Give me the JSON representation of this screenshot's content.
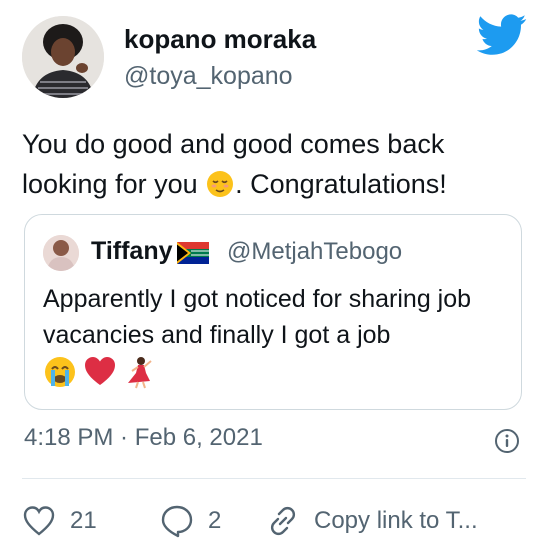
{
  "author": {
    "display_name": "kopano moraka",
    "handle": "@toya_kopano"
  },
  "tweet": {
    "text_before_emoji": "You do good and good comes back looking for you ",
    "text_after_emoji": ". Congratulations!",
    "inline_emoji": "relieved-face-emoji"
  },
  "quoted_tweet": {
    "display_name": "Tiffany",
    "name_emoji": "south-africa-flag-icon",
    "handle": "@MetjahTebogo",
    "text": "Apparently I got  noticed for sharing job vacancies and finally I got a job",
    "emojis": [
      "crying-face-emoji",
      "red-heart-emoji",
      "dancing-woman-emoji"
    ]
  },
  "meta": {
    "timestamp": "4:18 PM · Feb 6, 2021"
  },
  "actions": {
    "like_count": "21",
    "reply_count": "2",
    "share_label": "Copy link to T..."
  },
  "colors": {
    "twitter_blue": "#1d9bf0",
    "text_primary": "#0f1419",
    "text_secondary": "#536471",
    "border": "#cfd9de"
  }
}
